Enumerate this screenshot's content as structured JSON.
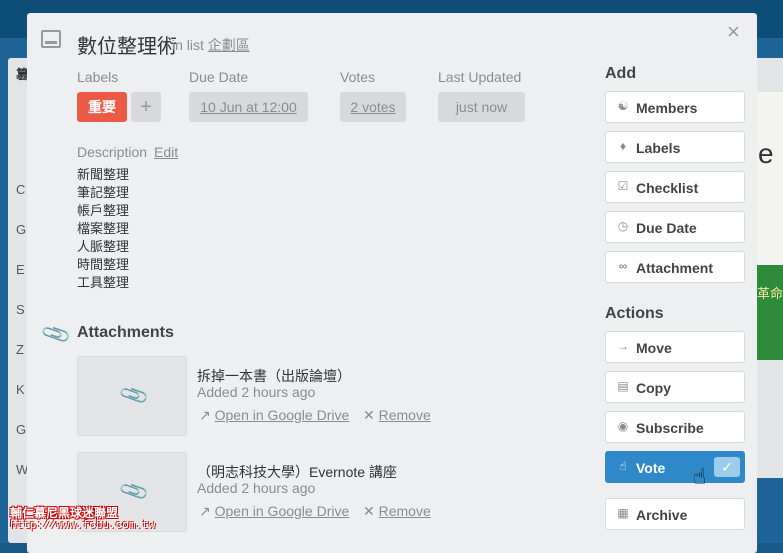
{
  "board": {
    "list_title": "篡",
    "list_items": [
      "C",
      "G",
      "E",
      "S",
      "Z",
      "K",
      "G",
      "W"
    ],
    "right_text": "e",
    "right_text2": "革命"
  },
  "card": {
    "title": "數位整理術",
    "in_list_prefix": "in list",
    "list_name": "企劃區",
    "close_glyph": "×"
  },
  "meta": {
    "labels_label": "Labels",
    "label_tag": "重要",
    "add_label": "+",
    "due_label": "Due Date",
    "due_value": "10 Jun at 12:00",
    "votes_label": "Votes",
    "votes_value": "2 votes",
    "updated_label": "Last Updated",
    "updated_value": "just now"
  },
  "description": {
    "label": "Description",
    "edit": "Edit",
    "lines": [
      "新聞整理",
      "筆記整理",
      "帳戶整理",
      "檔案整理",
      "人脈整理",
      "時間整理",
      "工具整理"
    ]
  },
  "attachments": {
    "title": "Attachments",
    "items": [
      {
        "name": "拆掉一本書（出版論壇）",
        "added": "Added 2 hours ago",
        "open": "Open in Google Drive",
        "remove": "Remove"
      },
      {
        "name": "（明志科技大學）Evernote 講座",
        "added": "Added 2 hours ago",
        "open": "Open in Google Drive",
        "remove": "Remove"
      }
    ]
  },
  "sidebar": {
    "add_title": "Add",
    "add_buttons": [
      {
        "label": "Members",
        "icon": "person-icon"
      },
      {
        "label": "Labels",
        "icon": "tag-icon"
      },
      {
        "label": "Checklist",
        "icon": "checkbox-icon"
      },
      {
        "label": "Due Date",
        "icon": "clock-icon"
      },
      {
        "label": "Attachment",
        "icon": "paperclip-icon"
      }
    ],
    "actions_title": "Actions",
    "action_buttons": [
      {
        "label": "Move",
        "icon": "arrow-right-icon"
      },
      {
        "label": "Copy",
        "icon": "card-icon"
      },
      {
        "label": "Subscribe",
        "icon": "eye-icon"
      },
      {
        "label": "Vote",
        "icon": "thumbs-up-icon",
        "active": true
      },
      {
        "label": "Archive",
        "icon": "archive-icon"
      }
    ]
  },
  "watermark": {
    "line1": "輔仁慕尼黑球迷聯盟",
    "line2": "http://www.fcbu.com.tw"
  },
  "colors": {
    "label_red": "#eb5a46",
    "vote_blue": "#2f89c8",
    "board_blue": "#1f6496"
  }
}
